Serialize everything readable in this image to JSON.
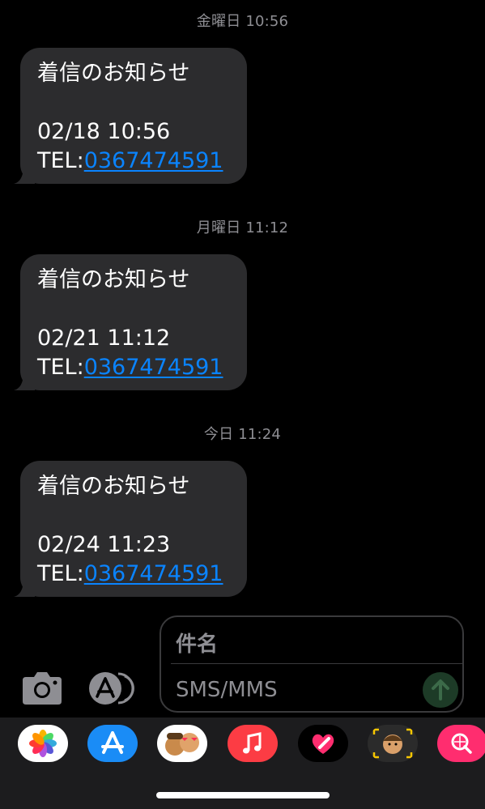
{
  "messages": [
    {
      "timestamp": "金曜日 10:56",
      "title": "着信のお知らせ",
      "datetime": "02/18 10:56",
      "tel_label": "TEL:",
      "tel_number": "0367474591"
    },
    {
      "timestamp": "月曜日 11:12",
      "title": "着信のお知らせ",
      "datetime": "02/21 11:12",
      "tel_label": "TEL:",
      "tel_number": "0367474591"
    },
    {
      "timestamp": "今日 11:24",
      "title": "着信のお知らせ",
      "datetime": "02/24 11:23",
      "tel_label": "TEL:",
      "tel_number": "0367474591"
    }
  ],
  "compose": {
    "subject_placeholder": "件名",
    "body_placeholder": "SMS/MMS"
  },
  "icons": {
    "camera": "camera-icon",
    "apps": "app-store-icon",
    "send": "send-arrow-icon"
  },
  "app_drawer": [
    "photos-app-icon",
    "app-store-app-icon",
    "memoji-stickers-icon",
    "music-app-icon",
    "digital-touch-icon",
    "memoji-icon",
    "image-search-icon"
  ],
  "colors": {
    "background": "#000000",
    "bubble": "#2c2c2e",
    "link": "#0a84ff",
    "timestamp": "#8e8e93"
  }
}
